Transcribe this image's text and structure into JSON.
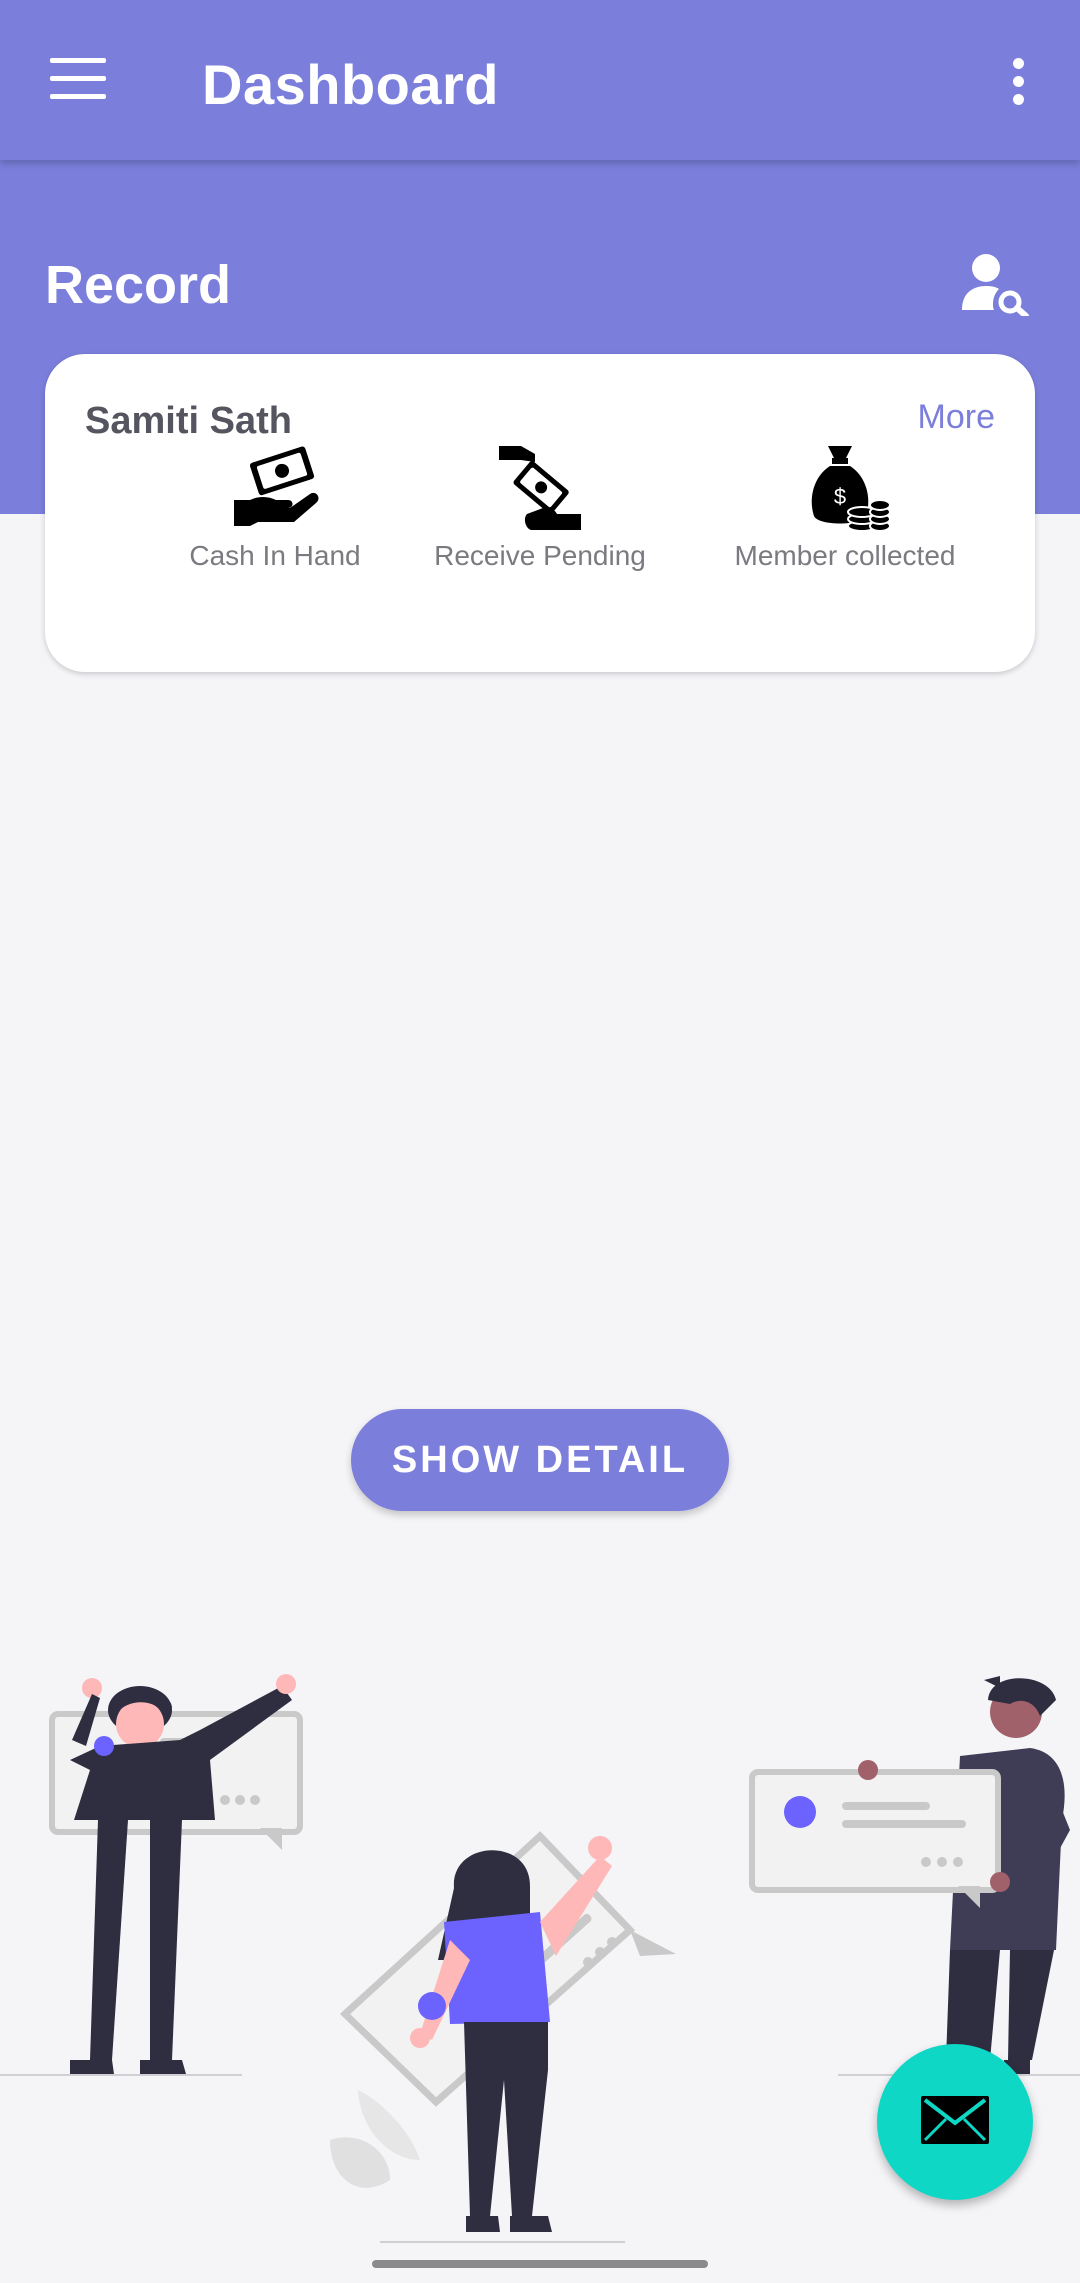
{
  "appbar": {
    "title": "Dashboard",
    "menu_icon": "hamburger-icon",
    "overflow_icon": "more-vert-icon"
  },
  "header": {
    "title": "Record",
    "search_icon": "user-search-icon"
  },
  "card": {
    "title": "Samiti Sath",
    "more_label": "More",
    "stats": [
      {
        "label": "Cash In Hand",
        "icon": "cash-in-hand-icon"
      },
      {
        "label": "Receive Pending",
        "icon": "receive-pending-icon"
      },
      {
        "label": "Member collected",
        "icon": "money-bag-icon"
      }
    ]
  },
  "actions": {
    "show_detail_label": "SHOW DETAIL"
  },
  "fab": {
    "icon": "mail-icon"
  },
  "colors": {
    "primary": "#7b7fdb",
    "fab": "#0fd7c5",
    "background": "#f5f5f8"
  }
}
